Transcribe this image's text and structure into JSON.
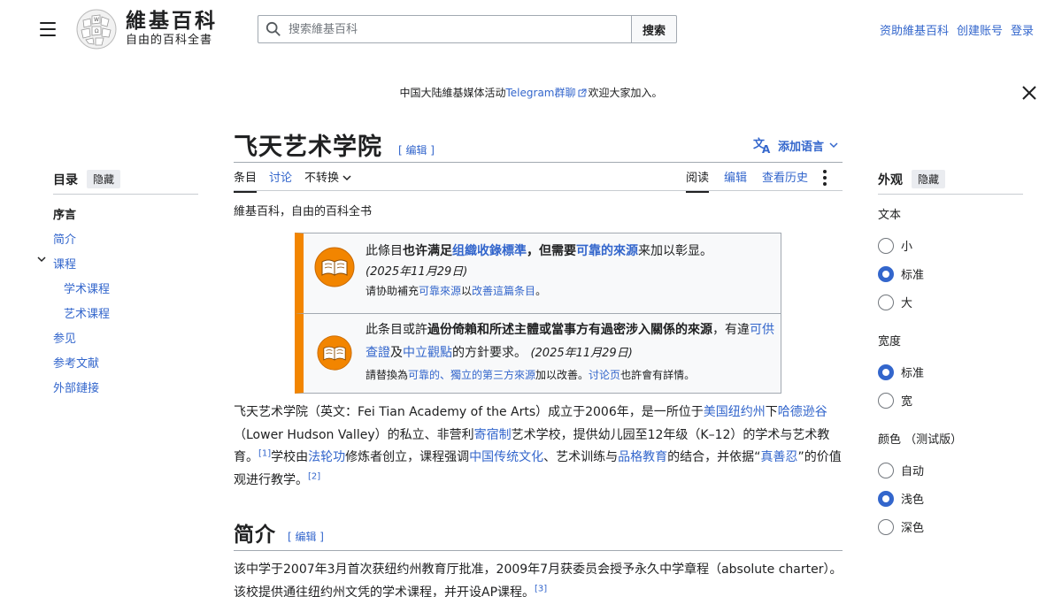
{
  "header": {
    "wordmark_title": "維基百科",
    "wordmark_tagline": "自由的百科全書",
    "search_placeholder": "搜索維基百科",
    "search_button": "搜索",
    "user_links": [
      "资助維基百科",
      "创建账号",
      "登录"
    ]
  },
  "notice": {
    "before": "中国大陆維基媒体活动",
    "link": "Telegram群聊",
    "after": "欢迎大家加入。"
  },
  "page": {
    "title": "飞天艺术学院",
    "edit_label": "[ 编辑 ]",
    "add_languages": "添加语言",
    "tabs_left": [
      "条目",
      "讨论",
      "不转换"
    ],
    "tabs_right": [
      "阅读",
      "编辑",
      "查看历史"
    ],
    "tagline": "維基百科，自由的百科全书"
  },
  "ambox1": {
    "p1": "此條目",
    "b1": "也许满足",
    "l1": "组織收錄標準",
    "b2": "，但需要",
    "l2": "可靠的來源",
    "p2": "来加以彰显。",
    "date": "(2025年11月29日)",
    "s1": "请协助補充",
    "sl1": "可靠來源",
    "s2": "以",
    "sl2": "改善這篇条目",
    "s3": "。"
  },
  "ambox2": {
    "p1": "此条目或許",
    "b1": "過份倚賴和所述主體或當事方有過密涉入關係的來源",
    "p2": "，有違",
    "l1": "可供查證",
    "p3": "及",
    "l2": "中立觀點",
    "p4": "的方針要求。",
    "date": "(2025年11月29日)",
    "s1": "請替換為",
    "sl1": "可靠的、獨立的第三方來源",
    "s2": "加以改善。",
    "sl2": "讨论页",
    "s3": "也許會有詳情。"
  },
  "intro": {
    "t1": "飞天艺术学院（英文：Fei Tian Academy of the Arts）成立于2006年，是一所位于",
    "l1": "美国纽约州",
    "t2": "下",
    "l2": "哈德逊谷",
    "t3": "（Lower Hudson Valley）的私立、非营利",
    "l3": "寄宿制",
    "t4": "艺术学校，提供幼儿园至12年级（K–12）的学术与艺术教育。",
    "ref1": "[1]",
    "t5": "学校由",
    "l4": "法轮功",
    "t6": "修炼者创立，课程强调",
    "l5": "中国传统文化",
    "t7": "、艺术训练与",
    "l6": "品格教育",
    "t8": "的结合，并依据“",
    "l7": "真善忍",
    "t9": "”的价值观进行教学。",
    "ref2": "[2]"
  },
  "section1": {
    "heading": "简介",
    "edit_label": "[ 编辑 ]",
    "t1": "该中学于2007年3月首次获纽约州教育厅批准，2009年7月获委员会授予永久中学章程（absolute charter）。该校提供通往纽约州文凭的学术课程，并开设AP课程。",
    "ref": "[3]"
  },
  "toc": {
    "title": "目录",
    "hide": "隐藏",
    "items": [
      "序言",
      "简介",
      "课程",
      "学术课程",
      "艺术课程",
      "参见",
      "参考文献",
      "外部鏈接"
    ]
  },
  "appearance": {
    "title": "外观",
    "hide": "隐藏",
    "text_label": "文本",
    "text_options": [
      "小",
      "标准",
      "大"
    ],
    "text_selected": "标准",
    "width_label": "宽度",
    "width_options": [
      "标准",
      "宽"
    ],
    "width_selected": "标准",
    "color_label": "颜色 （测试版）",
    "color_options": [
      "自动",
      "浅色",
      "深色"
    ],
    "color_selected": "浅色"
  },
  "icons": {
    "menu": "hamburger-icon",
    "search": "search-icon",
    "close": "close-icon",
    "translate": "translate-icon",
    "book": "book-icon",
    "more": "more-vertical-icon"
  },
  "colors": {
    "link": "#3366cc",
    "ambox_border": "#f28500",
    "text": "#202122"
  }
}
